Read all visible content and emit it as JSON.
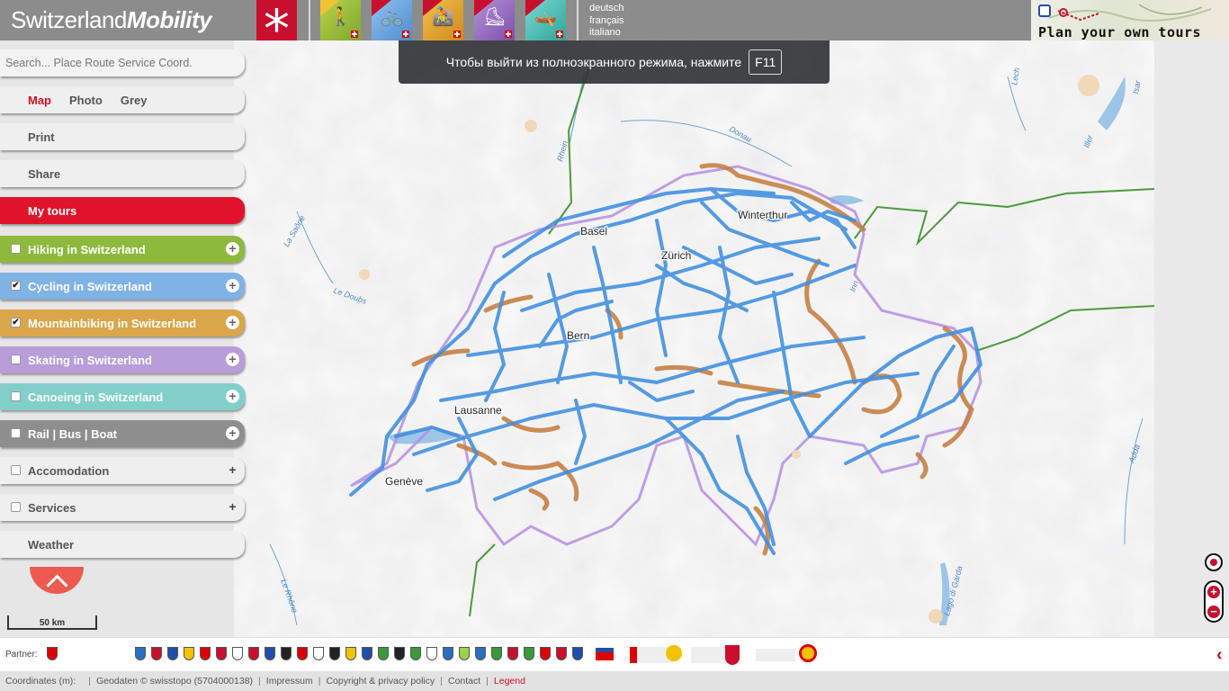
{
  "header": {
    "logo_text": "Switzerland",
    "logo_bold": "Mobility",
    "languages": [
      "deutsch",
      "français",
      "italiano"
    ],
    "plan_tours_label": "Plan your own tours",
    "mode_icons": [
      "hiking-icon",
      "cycling-icon",
      "mountainbiking-icon",
      "skating-icon",
      "canoeing-icon"
    ]
  },
  "toast": {
    "message": "Чтобы выйти из полноэкранного режима, нажмите",
    "key": "F11"
  },
  "sidebar": {
    "search_placeholder": "Search... Place Route Service Coord.",
    "map_types": [
      "Map",
      "Photo",
      "Grey"
    ],
    "print": "Print",
    "share": "Share",
    "my_tours": "My tours",
    "layers": [
      {
        "label": "Hiking in Switzerland",
        "checked": false,
        "color": "#8dba3c"
      },
      {
        "label": "Cycling in Switzerland",
        "checked": true,
        "color": "#7fb2e5"
      },
      {
        "label": "Mountainbiking in Switzerland",
        "checked": true,
        "color": "#d9a649"
      },
      {
        "label": "Skating in Switzerland",
        "checked": false,
        "color": "#b79ed8"
      },
      {
        "label": "Canoeing in Switzerland",
        "checked": false,
        "color": "#82cfc9"
      },
      {
        "label": "Rail | Bus | Boat",
        "checked": false,
        "color": "#8e8e8e"
      },
      {
        "label": "Accomodation",
        "checked": false,
        "color": "#efefef"
      },
      {
        "label": "Services",
        "checked": false,
        "color": "#efefef"
      }
    ],
    "weather": "Weather",
    "scale": "50 km"
  },
  "map": {
    "cities": [
      "Basel",
      "Zürich",
      "Winterthur",
      "Bern",
      "Lausanne",
      "Genève"
    ],
    "rivers": [
      "Rhein",
      "Donau",
      "La Saône",
      "Le Doubs",
      "Le Rhône",
      "Adda",
      "Inn",
      "Lech",
      "Iller",
      "Isar",
      "Lago di Garda"
    ]
  },
  "partners": {
    "label": "Partner:"
  },
  "footer": {
    "coordinates": "Coordinates (m):",
    "geodata": "Geodaten © swisstopo (5704000138)",
    "impressum": "Impressum",
    "copyright": "Copyright & privacy policy",
    "contact": "Contact",
    "legend": "Legend"
  }
}
